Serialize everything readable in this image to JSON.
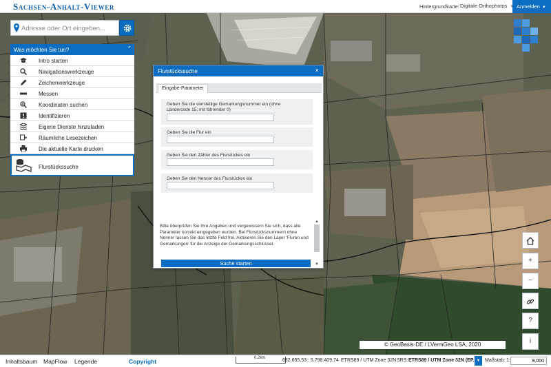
{
  "app": {
    "title": "Sachsen-Anhalt-Viewer"
  },
  "header": {
    "background_label": "Hintergrundkarte:",
    "background_value": "Digitale Orthophotos",
    "login_label": "Anmelden"
  },
  "search": {
    "placeholder": "Adresse oder Ort eingeben..."
  },
  "tools": {
    "header": "Was möchten Sie tun?",
    "items": [
      {
        "label": "Intro starten",
        "icon": "grad-cap-icon"
      },
      {
        "label": "Navigationswerkzeuge",
        "icon": "zoom-icon"
      },
      {
        "label": "Zeichenwerkzeuge",
        "icon": "pencil-icon"
      },
      {
        "label": "Messen",
        "icon": "ruler-icon"
      },
      {
        "label": "Koordinaten suchen",
        "icon": "search-coords-icon"
      },
      {
        "label": "Identifizieren",
        "icon": "identify-icon"
      },
      {
        "label": "Eigene Dienste hinzuladen",
        "icon": "layers-add-icon"
      },
      {
        "label": "Räumliche Lesezeichen",
        "icon": "bookmark-icon"
      },
      {
        "label": "Die aktuelle Karte drucken",
        "icon": "print-icon"
      }
    ],
    "active": {
      "label": "Flurstückssuche",
      "icon": "parcel-search-icon"
    }
  },
  "dialog": {
    "title": "Flurstückssuche",
    "tab": "Eingabe-Parameter",
    "fields": [
      {
        "label": "Geben Sie die vierstellige Gemarkungsnummer ein (ohne Ländercode 15, mit führender 0)",
        "value": ""
      },
      {
        "label": "Geben Sie die Flur ein",
        "value": ""
      },
      {
        "label": "Geben Sie den Zähler des Flurstückes ein",
        "value": ""
      },
      {
        "label": "Geben Sie den Nenner des Flurstückes ein",
        "value": ""
      }
    ],
    "info": "Bitte überprüfen Sie Ihre Angaben und vergewissern Sie sich, dass alle Parameter korrekt eingegeben wurden. Bei Flurstücksnummern ohne Nenner lassen Sie das letzte Feld frei. Aktivieren Sie den Layer 'Fluren und Gemarkungen' für die Anzeige der Gemarkungsschlüssel.",
    "submit": "Suche starten"
  },
  "map": {
    "copyright": "© GeoBasis-DE / LVermGeo LSA, 2020",
    "controls": [
      "home-icon",
      "zoom-in-icon",
      "zoom-out-icon",
      "link-icon",
      "help-icon",
      "info-icon"
    ]
  },
  "footer": {
    "tabs": [
      "Inhaltsbaum",
      "MapFlow",
      "Legende"
    ],
    "copyright_link": "Copyright",
    "scale_bar": "0.2km",
    "coordinates": "682.655,53 : 5.798.409,74",
    "crs_display": "ETRS89 / UTM Zone 32N",
    "srs_label": "SRS:",
    "srs_value": "ETRS89 / UTM Zone 32N (EP...",
    "scale_label": "Maßstab: 1:",
    "scale_value": "9.000"
  },
  "colors": {
    "accent": "#0a6dc2",
    "map_dark": "#4f5a3e",
    "field": "#b89a7a"
  }
}
